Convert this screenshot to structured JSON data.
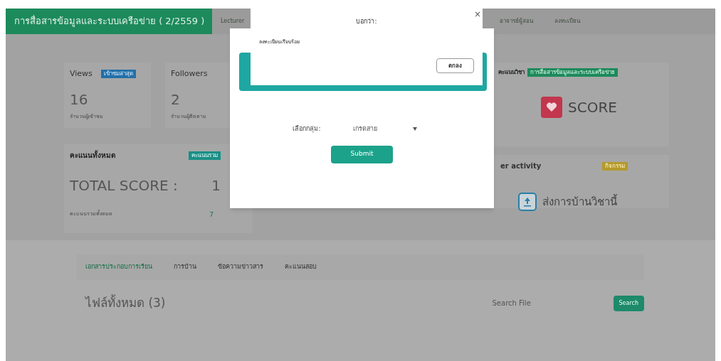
{
  "header": {
    "course_title": "การสื่อสารข้อมูลและระบบเครือข่าย ( 2/2559 )",
    "nav": [
      {
        "label": "Lecturer"
      },
      {
        "label": "อาจารย์ผู้สอน"
      },
      {
        "label": "ลงทะเบียน"
      }
    ]
  },
  "stats": [
    {
      "title": "Views",
      "badge": "เข้าชมล่าสุด",
      "value": "16",
      "caption": "จำนวนผู้เข้าชม"
    },
    {
      "title": "Followers",
      "value": "2",
      "caption": "จำนวนผู้ติดตาม"
    }
  ],
  "score_card": {
    "title": "คะแนนวิชา",
    "badge": "การสื่อสารข้อมูลและระบบเครือข่าย",
    "label": "SCORE"
  },
  "total_card": {
    "title": "คะแนนทั้งหมด",
    "badge": "คะแนนรวม",
    "label": "TOTAL SCORE :",
    "value": "1",
    "row_label": "คะแนนรวมทั้งหมด",
    "row_value": "7"
  },
  "activity_card": {
    "title": "er activity",
    "badge": "กิจกรรม",
    "link": "ส่งการบ้านวิชานี้"
  },
  "tabs": [
    {
      "label": "เอกสารประกอบการเรียน",
      "selected": true
    },
    {
      "label": "การบ้าน",
      "selected": false
    },
    {
      "label": "ข้อความข่าวสาร",
      "selected": false
    },
    {
      "label": "คะแนนสอบ",
      "selected": false
    }
  ],
  "files": {
    "heading": "ไฟล์ทั้งหมด (3)",
    "search_placeholder": "Search File",
    "search_button": "Search"
  },
  "modal": {
    "close": "×",
    "group_label": "เลือกกลุ่ม:",
    "group_value": "เกรดสาย",
    "submit": "Submit"
  },
  "alert": {
    "title": "บอกว่า:",
    "message": "ลงทะเบียนเรียบร้อย",
    "ok": "ตกลง"
  }
}
